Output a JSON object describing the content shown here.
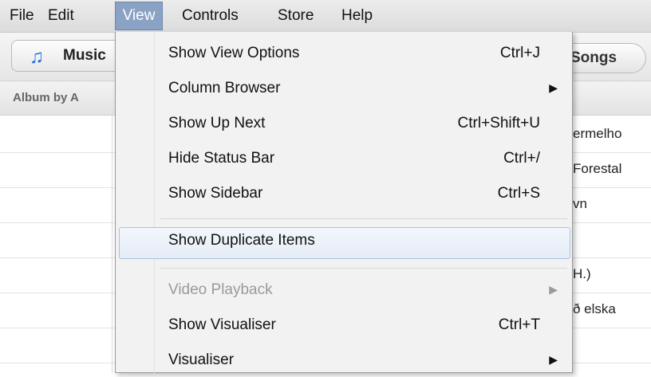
{
  "menubar": {
    "items": [
      "File",
      "Edit",
      "View",
      "Controls",
      "Store",
      "Help"
    ],
    "active": "View"
  },
  "toolbar": {
    "source_label": "Music",
    "source_icon": "music-note-icon",
    "songs_label": "Songs"
  },
  "table": {
    "column_header": "Album by A",
    "rows": [
      "ermelho",
      "Forestal",
      "vn",
      "",
      "H.)",
      "ð elska",
      ""
    ]
  },
  "view_menu": {
    "items": [
      {
        "label": "Show View Options",
        "shortcut": "Ctrl+J",
        "submenu": false,
        "disabled": false
      },
      {
        "label": "Column Browser",
        "shortcut": "",
        "submenu": true,
        "disabled": false
      },
      {
        "label": "Show Up Next",
        "shortcut": "Ctrl+Shift+U",
        "submenu": false,
        "disabled": false
      },
      {
        "label": "Hide Status Bar",
        "shortcut": "Ctrl+/",
        "submenu": false,
        "disabled": false
      },
      {
        "label": "Show Sidebar",
        "shortcut": "Ctrl+S",
        "submenu": false,
        "disabled": false
      },
      {
        "label": "Show Duplicate Items",
        "shortcut": "",
        "submenu": false,
        "disabled": false,
        "highlighted": true
      },
      {
        "label": "Video Playback",
        "shortcut": "",
        "submenu": true,
        "disabled": true
      },
      {
        "label": "Show Visualiser",
        "shortcut": "Ctrl+T",
        "submenu": false,
        "disabled": false
      },
      {
        "label": "Visualiser",
        "shortcut": "",
        "submenu": true,
        "disabled": false
      }
    ],
    "submenu_arrow": "▶"
  },
  "colors": {
    "menu_active_bg": "#8aa2c4",
    "menu_highlight_border": "#a9c0e0",
    "disabled_text": "#9a9a9a",
    "music_icon": "#1f6fe0"
  }
}
